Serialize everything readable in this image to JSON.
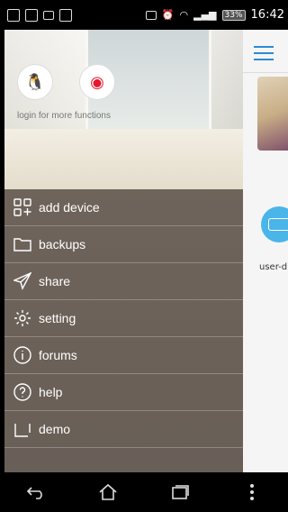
{
  "status_bar": {
    "battery": "33%",
    "time": "16:42"
  },
  "drawer": {
    "login_text": "login for more functions",
    "menu": [
      {
        "label": "add device",
        "icon": "add-device-icon"
      },
      {
        "label": "backups",
        "icon": "folder-icon"
      },
      {
        "label": "share",
        "icon": "send-icon"
      },
      {
        "label": "setting",
        "icon": "gear-icon"
      },
      {
        "label": "forums",
        "icon": "info-icon"
      },
      {
        "label": "help",
        "icon": "question-icon"
      },
      {
        "label": "demo",
        "icon": "demo-icon"
      }
    ]
  },
  "main": {
    "device_label": "user-d"
  }
}
